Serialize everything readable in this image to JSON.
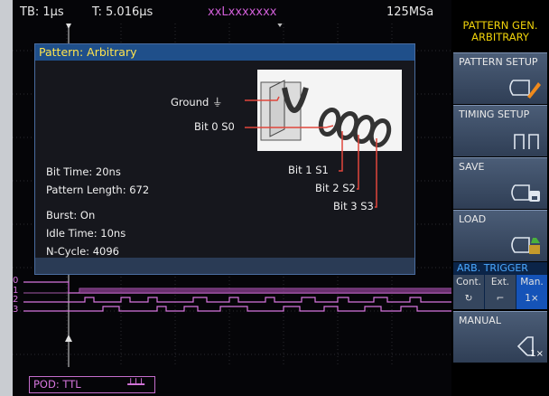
{
  "topbar": {
    "timebase": "TB: 1µs",
    "trigger_time": "T: 5.016µs",
    "trigger_source": "xxLxxxxxxx",
    "sample_rate": "125MSa"
  },
  "dialog": {
    "title": "Pattern: Arbitrary",
    "pins": {
      "ground": "Ground ⏚",
      "bit0": "Bit 0 S0",
      "bit1": "Bit 1 S1",
      "bit2": "Bit 2 S2",
      "bit3": "Bit 3 S3"
    },
    "info": {
      "bit_time": "Bit Time: 20ns",
      "pattern_length": "Pattern Length: 672",
      "burst": "Burst: On",
      "idle_time": "Idle Time: 10ns",
      "n_cycle": "N-Cycle: 4096"
    }
  },
  "channels": [
    "0",
    "1",
    "2",
    "3"
  ],
  "pod": {
    "label": "POD: TTL"
  },
  "sidebar": {
    "header_line1": "PATTERN GEN.",
    "header_line2": "ARBITRARY",
    "pattern_setup": "PATTERN SETUP",
    "timing_setup": "TIMING SETUP",
    "save": "SAVE",
    "load": "LOAD",
    "arb_trigger": {
      "title": "ARB. TRIGGER",
      "options": [
        {
          "label": "Cont.",
          "symbol": "↻"
        },
        {
          "label": "Ext.",
          "symbol": "⌐"
        },
        {
          "label": "Man.",
          "symbol": "1×"
        }
      ],
      "selected": "Man."
    },
    "manual": "MANUAL",
    "manual_symbol": "1×"
  },
  "colors": {
    "accent_yellow": "#ffe44d",
    "digital_magenta": "#d776de",
    "highlight_blue": "#1553b8",
    "ui_blue": "#1f4f8a"
  }
}
